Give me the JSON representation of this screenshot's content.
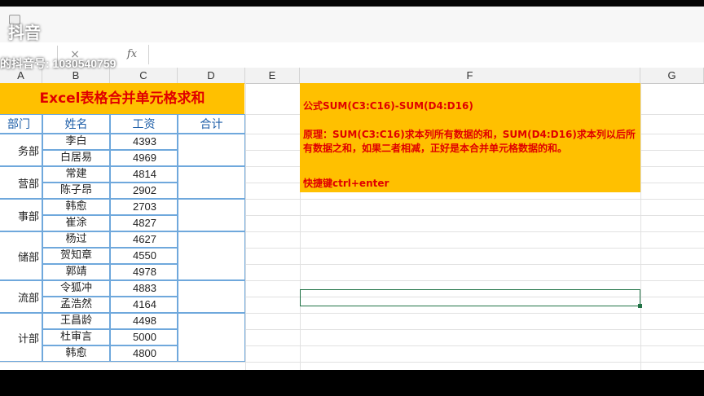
{
  "watermark": {
    "logo_text": "抖音",
    "account_text": "的抖音号: 1030540759"
  },
  "formula_bar": {
    "fx": "fx",
    "cancel": "×",
    "value": ""
  },
  "columns": [
    "A",
    "B",
    "C",
    "D",
    "E",
    "F",
    "G"
  ],
  "table": {
    "title": "Excel表格合并单元格求和",
    "headers": [
      "部门",
      "姓名",
      "工资",
      "合计"
    ],
    "departments": [
      "务部",
      "营部",
      "事部",
      "储部",
      "流部",
      "计部"
    ],
    "rows": [
      {
        "name": "李白",
        "salary": "4393"
      },
      {
        "name": "白居易",
        "salary": "4969"
      },
      {
        "name": "常建",
        "salary": "4814"
      },
      {
        "name": "陈子昂",
        "salary": "2902"
      },
      {
        "name": "韩愈",
        "salary": "2703"
      },
      {
        "name": "崔涂",
        "salary": "4827"
      },
      {
        "name": "杨过",
        "salary": "4627"
      },
      {
        "name": "贺知章",
        "salary": "4550"
      },
      {
        "name": "郭靖",
        "salary": "4978"
      },
      {
        "name": "令狐冲",
        "salary": "4883"
      },
      {
        "name": "孟浩然",
        "salary": "4164"
      },
      {
        "name": "王昌龄",
        "salary": "4498"
      },
      {
        "name": "杜审言",
        "salary": "5000"
      },
      {
        "name": "韩愈",
        "salary": "4800"
      }
    ]
  },
  "note": {
    "formula": "公式SUM(C3:C16)-SUM(D4:D16)",
    "principle": "原理：SUM(C3:C16)求本列所有数据的和，SUM(D4:D16)求本列以后所有数据之和，如果二者相减，正好是本合并单元格数据的和。",
    "shortcut": "快捷键ctrl+enter"
  },
  "colors": {
    "banner": "#ffc000",
    "red_text": "#e00000",
    "header_blue": "#1f5fa8",
    "border_blue": "#6fa8dc",
    "selection_green": "#217346"
  }
}
